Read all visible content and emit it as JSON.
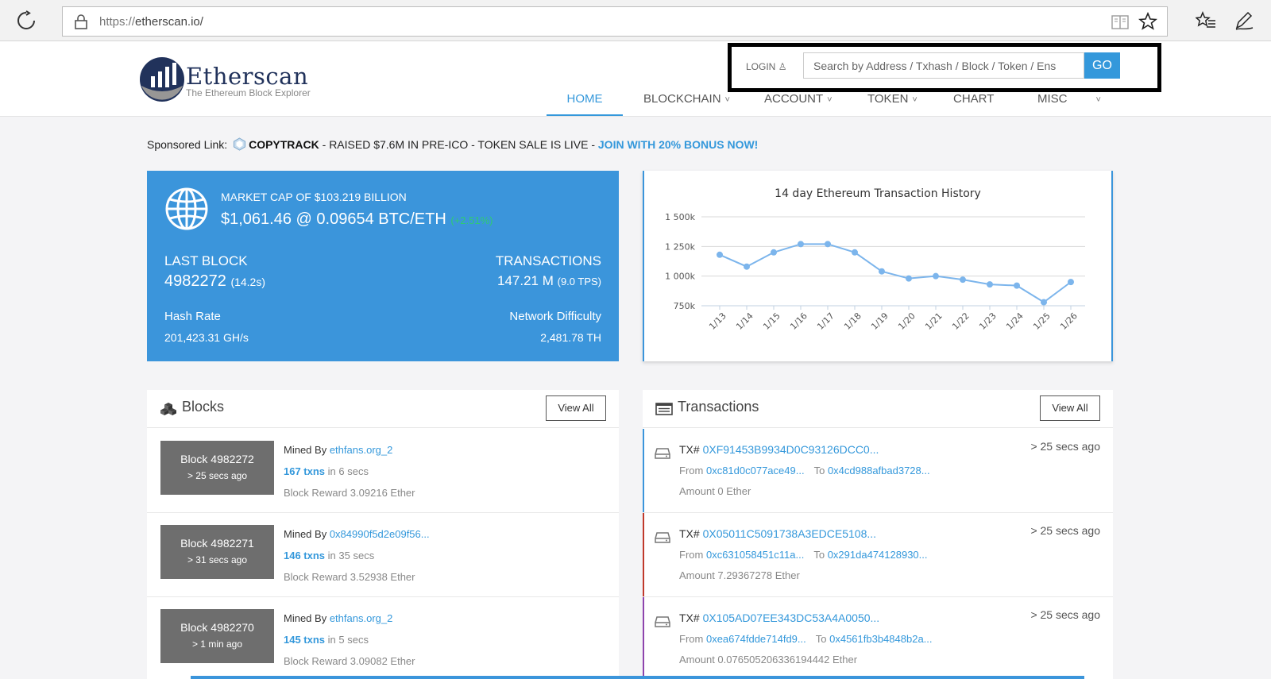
{
  "browser": {
    "url_proto": "https://",
    "url_host": "etherscan.io/"
  },
  "header": {
    "logo_title": "Etherscan",
    "logo_subtitle": "The Ethereum Block Explorer",
    "login_label": "LOGIN",
    "search_placeholder": "Search by Address / Txhash / Block / Token / Ens",
    "go_label": "GO",
    "nav": [
      {
        "label": "HOME"
      },
      {
        "label": "BLOCKCHAIN"
      },
      {
        "label": "ACCOUNT"
      },
      {
        "label": "TOKEN"
      },
      {
        "label": "CHART"
      },
      {
        "label": "MISC"
      }
    ]
  },
  "sponsored": {
    "prefix": "Sponsored Link:",
    "brand": "COPYTRACK",
    "text": " - RAISED $7.6M IN PRE-ICO - TOKEN SALE IS LIVE - ",
    "cta": "JOIN WITH 20% BONUS NOW!"
  },
  "stats": {
    "market_cap": "MARKET CAP OF $103.219 BILLION",
    "price": "$1,061.46 @ 0.09654 BTC/ETH",
    "change": "(+2.51%)",
    "last_block_label": "LAST BLOCK",
    "last_block_value": "4982272",
    "last_block_time": "(14.2s)",
    "transactions_label": "TRANSACTIONS",
    "transactions_value": "147.21 M",
    "tps": "(9.0 TPS)",
    "hash_rate_label": "Hash Rate",
    "hash_rate_value": "201,423.31 GH/s",
    "difficulty_label": "Network Difficulty",
    "difficulty_value": "2,481.78 TH"
  },
  "chart_data": {
    "type": "line",
    "title": "14 day Ethereum Transaction History",
    "categories": [
      "1/13",
      "1/14",
      "1/15",
      "1/16",
      "1/17",
      "1/18",
      "1/19",
      "1/20",
      "1/21",
      "1/22",
      "1/23",
      "1/24",
      "1/25",
      "1/26"
    ],
    "values": [
      1180000,
      1080000,
      1200000,
      1270000,
      1270000,
      1200000,
      1040000,
      980000,
      1000000,
      970000,
      930000,
      920000,
      780000,
      950000
    ],
    "yticks": [
      750000,
      1000000,
      1250000,
      1500000
    ],
    "ytick_labels": [
      "750k",
      "1 000k",
      "1 250k",
      "1 500k"
    ],
    "ylim": [
      750000,
      1500000
    ],
    "grid": true,
    "color": "#7cb5ec"
  },
  "blocks": {
    "title": "Blocks",
    "view_all": "View All",
    "mined_by_label": "Mined By",
    "items": [
      {
        "block": "Block 4982272",
        "ago": "> 25 secs ago",
        "miner": "ethfans.org_2",
        "txns": "167 txns",
        "in": "in 6 secs",
        "reward": "Block Reward 3.09216 Ether"
      },
      {
        "block": "Block 4982271",
        "ago": "> 31 secs ago",
        "miner": "0x84990f5d2e09f56...",
        "txns": "146 txns",
        "in": "in 35 secs",
        "reward": "Block Reward 3.52938 Ether"
      },
      {
        "block": "Block 4982270",
        "ago": "> 1 min ago",
        "miner": "ethfans.org_2",
        "txns": "145 txns",
        "in": "in 5 secs",
        "reward": "Block Reward 3.09082 Ether"
      }
    ]
  },
  "transactions": {
    "title": "Transactions",
    "view_all": "View All",
    "tx_label": "TX#",
    "from_label": "From",
    "to_label": "To",
    "items": [
      {
        "hash": "0XF91453B9934D0C93126DCC0...",
        "ago": "> 25 secs ago",
        "from": "0xc81d0c077ace49...",
        "to": "0x4cd988afbad3728...",
        "amount": "Amount 0 Ether",
        "bar": "#3b95db"
      },
      {
        "hash": "0X05011C5091738A3EDCE5108...",
        "ago": "> 25 secs ago",
        "from": "0xc631058451c11a...",
        "to": "0x291da474128930...",
        "amount": "Amount 7.29367278 Ether",
        "bar": "#c0392b"
      },
      {
        "hash": "0X105AD07EE343DC53A4A0050...",
        "ago": "> 25 secs ago",
        "from": "0xea674fdde714fd9...",
        "to": "0x4561fb3b4848b2a...",
        "amount": "Amount 0.076505206336194442 Ether",
        "bar": "#8e44ad"
      }
    ]
  }
}
